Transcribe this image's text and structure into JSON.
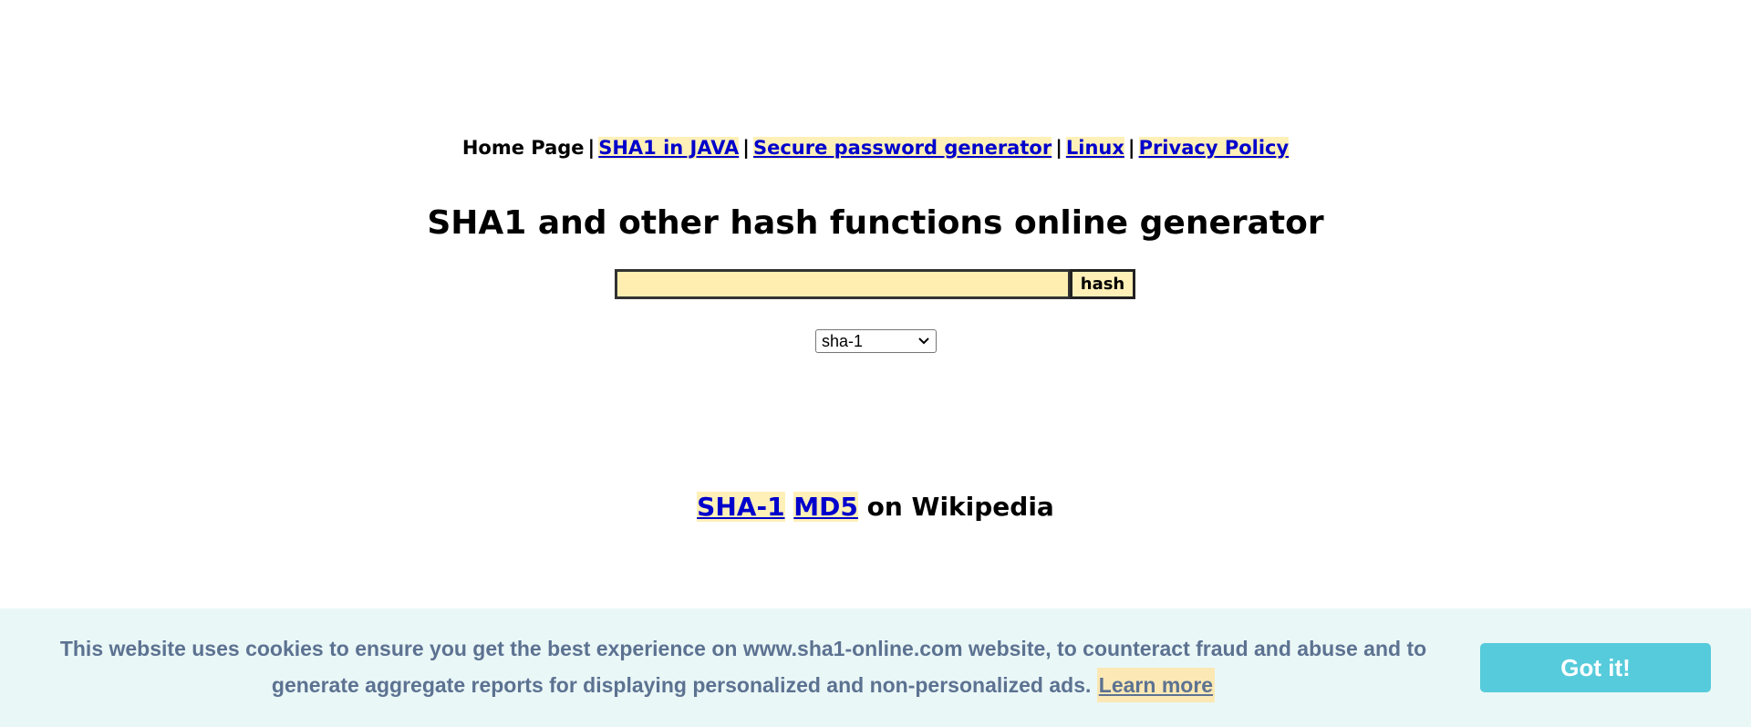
{
  "nav": {
    "home": "Home Page",
    "separator": "|",
    "links": [
      "SHA1 in JAVA",
      "Secure password generator",
      "Linux",
      "Privacy Policy"
    ]
  },
  "title": "SHA1 and other hash functions online generator",
  "hash_form": {
    "input_value": "",
    "button_label": "hash"
  },
  "algorithm_select": {
    "selected": "sha-1"
  },
  "wiki": {
    "links": [
      "SHA-1",
      "MD5"
    ],
    "suffix": "on Wikipedia"
  },
  "cookie_banner": {
    "message": "This website uses cookies to ensure you get the best experience on www.sha1-online.com website, to counteract fraud and abuse and to generate aggregate reports for displaying personalized and non-personalized ads.",
    "learn_more": "Learn more",
    "accept_label": "Got it!",
    "background": "#eaf7f7",
    "button_color": "#56cbdb",
    "text_color": "#5c7291"
  },
  "colors": {
    "link": "#0000cc",
    "highlight": "#fff0b8",
    "input_bg": "#ffeeb0"
  }
}
